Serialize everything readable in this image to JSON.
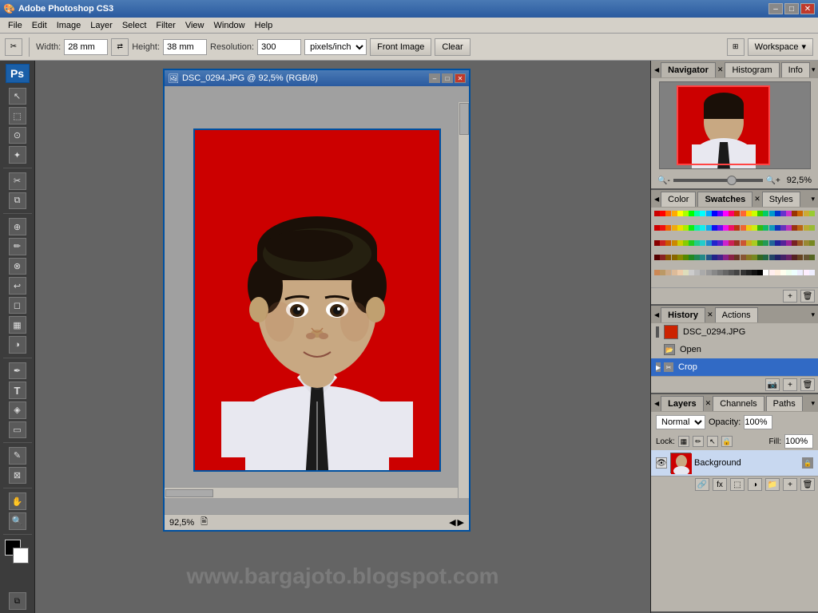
{
  "app": {
    "title": "Adobe Photoshop CS3",
    "ps_logo": "Ps"
  },
  "titlebar": {
    "title": "Adobe Photoshop CS3",
    "min": "–",
    "max": "□",
    "close": "✕"
  },
  "menubar": {
    "items": [
      "File",
      "Edit",
      "Image",
      "Layer",
      "Select",
      "Filter",
      "View",
      "Window",
      "Help"
    ]
  },
  "toolbar": {
    "width_label": "Width:",
    "width_value": "28 mm",
    "height_label": "Height:",
    "height_value": "38 mm",
    "resolution_label": "Resolution:",
    "resolution_value": "300",
    "resolution_unit": "pixels/inch",
    "front_image_label": "Front Image",
    "clear_label": "Clear",
    "workspace_label": "Workspace"
  },
  "document": {
    "title": "DSC_0294.JPG @ 92,5% (RGB/8)",
    "zoom": "92,5%",
    "min": "–",
    "max": "□",
    "close": "✕"
  },
  "navigator": {
    "label": "Navigator",
    "histogram_label": "Histogram",
    "info_label": "Info",
    "zoom_value": "92,5%"
  },
  "color_panel": {
    "color_label": "Color",
    "swatches_label": "Swatches",
    "styles_label": "Styles"
  },
  "history": {
    "label": "History",
    "actions_label": "Actions",
    "items": [
      {
        "id": 1,
        "label": "DSC_0294.JPG",
        "type": "thumb"
      },
      {
        "id": 2,
        "label": "Open",
        "type": "icon"
      },
      {
        "id": 3,
        "label": "Crop",
        "type": "icon",
        "active": true
      }
    ]
  },
  "layers": {
    "label": "Layers",
    "channels_label": "Channels",
    "paths_label": "Paths",
    "blend_mode": "Normal",
    "opacity_label": "Opacity:",
    "opacity_value": "100%",
    "fill_label": "Fill:",
    "fill_value": "100%",
    "lock_label": "Lock:",
    "items": [
      {
        "id": 1,
        "name": "Background",
        "visible": true
      }
    ]
  },
  "swatches_colors": [
    "#cc0000",
    "#ff0000",
    "#ff6600",
    "#ffaa00",
    "#ffff00",
    "#aaff00",
    "#00ff00",
    "#00ffaa",
    "#00ffff",
    "#00aaff",
    "#0000ff",
    "#6600ff",
    "#ff00ff",
    "#ff0066",
    "#cc3300",
    "#ff6633",
    "#ffcc00",
    "#ccff00",
    "#33cc00",
    "#00cc66",
    "#0099cc",
    "#0033cc",
    "#6633cc",
    "#cc33cc",
    "#993300",
    "#cc6600",
    "#ccaa33",
    "#99cc33",
    "#cc0000",
    "#ee1111",
    "#ee6600",
    "#eeaa11",
    "#eedd00",
    "#aaee00",
    "#11ee11",
    "#11eeaa",
    "#11eeee",
    "#11aaee",
    "#1111ee",
    "#6611ee",
    "#ee11ee",
    "#ee1166",
    "#bb3311",
    "#ee6633",
    "#eecc11",
    "#ccee11",
    "#33bb11",
    "#11bb66",
    "#1199bb",
    "#1133bb",
    "#6633bb",
    "#bb33bb",
    "#993311",
    "#bb6611",
    "#bbaa33",
    "#99bb33",
    "#880000",
    "#cc2222",
    "#cc5500",
    "#cc8800",
    "#cccc00",
    "#88cc00",
    "#22cc22",
    "#22cc88",
    "#22cccc",
    "#2288cc",
    "#2222cc",
    "#5522cc",
    "#cc22cc",
    "#cc2255",
    "#993322",
    "#cc5533",
    "#ccaa22",
    "#aacc22",
    "#339922",
    "#229955",
    "#226699",
    "#222299",
    "#552299",
    "#992299",
    "#772222",
    "#995522",
    "#998833",
    "#778822",
    "#550000",
    "#882222",
    "#885500",
    "#886600",
    "#888800",
    "#558800",
    "#228822",
    "#228855",
    "#228888",
    "#225588",
    "#222288",
    "#442288",
    "#882288",
    "#882244",
    "#663322",
    "#885533",
    "#887722",
    "#778822",
    "#336622",
    "#226644",
    "#224466",
    "#222266",
    "#442266",
    "#662266",
    "#552222",
    "#664422",
    "#665533",
    "#556622",
    "#cc8855",
    "#bb9966",
    "#ccaa88",
    "#ddbb99",
    "#eeccaa",
    "#ddddbb",
    "#cccccc",
    "#bbbbbb",
    "#aaaaaa",
    "#999999",
    "#888888",
    "#777777",
    "#666666",
    "#555555",
    "#444444",
    "#333333",
    "#222222",
    "#111111",
    "#000000",
    "#ffffff",
    "#ffeeee",
    "#ffeedd",
    "#ffffee",
    "#eeffee",
    "#eeffff",
    "#eeeeff",
    "#ffeeff",
    "#eeeeff"
  ],
  "watermark": "www.bargajoto.blogspot.com"
}
